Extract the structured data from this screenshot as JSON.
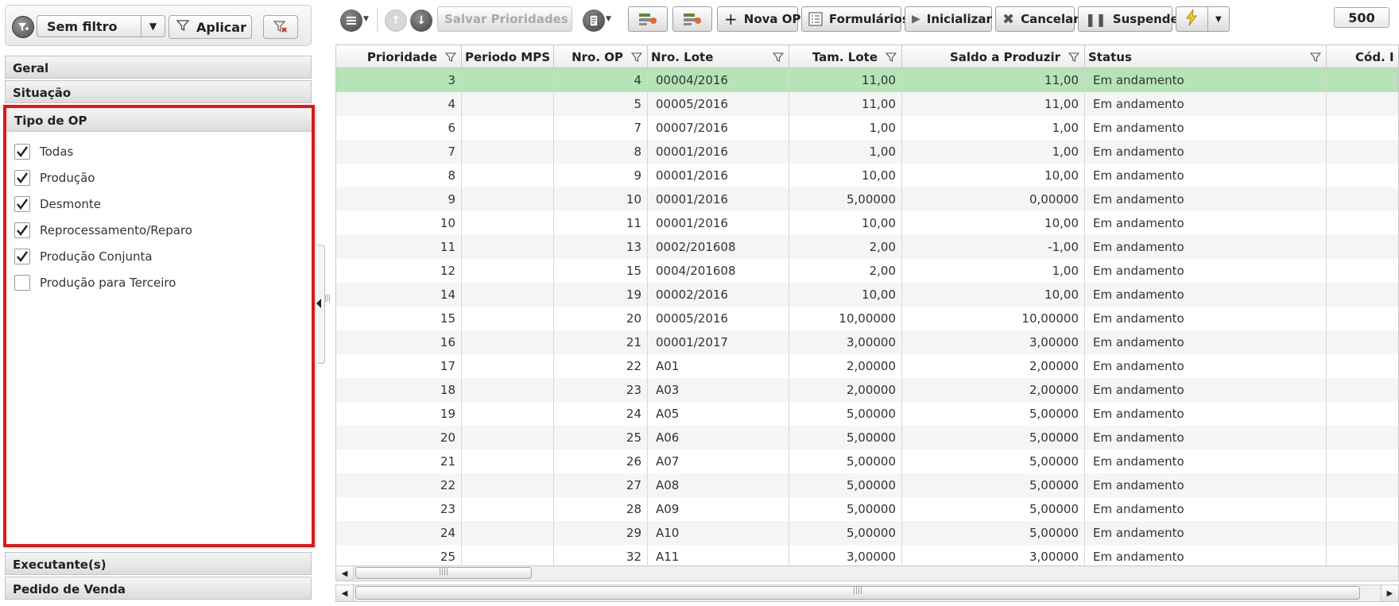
{
  "filter_bar": {
    "filter_select": "Sem filtro",
    "apply_label": "Aplicar"
  },
  "accordion": {
    "geral": "Geral",
    "situacao": "Situação",
    "tipo_op": "Tipo de OP",
    "executantes": "Executante(s)",
    "pedido_venda": "Pedido de Venda"
  },
  "tipo_op_options": [
    {
      "label": "Todas",
      "checked": true
    },
    {
      "label": "Produção",
      "checked": true
    },
    {
      "label": "Desmonte",
      "checked": true
    },
    {
      "label": "Reprocessamento/Reparo",
      "checked": true
    },
    {
      "label": "Produção Conjunta",
      "checked": true
    },
    {
      "label": "Produção para Terceiro",
      "checked": false
    }
  ],
  "toolbar": {
    "save_priorities": "Salvar Prioridades",
    "new_op": "Nova OP",
    "forms": "Formulários",
    "initialize": "Inicializar",
    "cancel": "Cancelar",
    "suspend": "Suspender",
    "page_size": "500"
  },
  "grid": {
    "headers": {
      "prioridade": "Prioridade",
      "periodo_mps": "Periodo MPS",
      "nro_op": "Nro. OP",
      "nro_lote": "Nro. Lote",
      "tam_lote": "Tam. Lote",
      "saldo": "Saldo a Produzir",
      "status": "Status",
      "cod": "Cód. I"
    },
    "rows": [
      {
        "prioridade": "3",
        "periodo": "",
        "op": "4",
        "lote": "00004/2016",
        "tam": "11,00",
        "saldo": "11,00",
        "status": "Em andamento"
      },
      {
        "prioridade": "4",
        "periodo": "",
        "op": "5",
        "lote": "00005/2016",
        "tam": "11,00",
        "saldo": "11,00",
        "status": "Em andamento"
      },
      {
        "prioridade": "6",
        "periodo": "",
        "op": "7",
        "lote": "00007/2016",
        "tam": "1,00",
        "saldo": "1,00",
        "status": "Em andamento"
      },
      {
        "prioridade": "7",
        "periodo": "",
        "op": "8",
        "lote": "00001/2016",
        "tam": "1,00",
        "saldo": "1,00",
        "status": "Em andamento"
      },
      {
        "prioridade": "8",
        "periodo": "",
        "op": "9",
        "lote": "00001/2016",
        "tam": "10,00",
        "saldo": "10,00",
        "status": "Em andamento"
      },
      {
        "prioridade": "9",
        "periodo": "",
        "op": "10",
        "lote": "00001/2016",
        "tam": "5,00000",
        "saldo": "0,00000",
        "status": "Em andamento"
      },
      {
        "prioridade": "10",
        "periodo": "",
        "op": "11",
        "lote": "00001/2016",
        "tam": "10,00",
        "saldo": "10,00",
        "status": "Em andamento"
      },
      {
        "prioridade": "11",
        "periodo": "",
        "op": "13",
        "lote": "0002/201608",
        "tam": "2,00",
        "saldo": "-1,00",
        "status": "Em andamento"
      },
      {
        "prioridade": "12",
        "periodo": "",
        "op": "15",
        "lote": "0004/201608",
        "tam": "2,00",
        "saldo": "1,00",
        "status": "Em andamento"
      },
      {
        "prioridade": "14",
        "periodo": "",
        "op": "19",
        "lote": "00002/2016",
        "tam": "10,00",
        "saldo": "10,00",
        "status": "Em andamento"
      },
      {
        "prioridade": "15",
        "periodo": "",
        "op": "20",
        "lote": "00005/2016",
        "tam": "10,00000",
        "saldo": "10,00000",
        "status": "Em andamento"
      },
      {
        "prioridade": "16",
        "periodo": "",
        "op": "21",
        "lote": "00001/2017",
        "tam": "3,00000",
        "saldo": "3,00000",
        "status": "Em andamento"
      },
      {
        "prioridade": "17",
        "periodo": "",
        "op": "22",
        "lote": "A01",
        "tam": "2,00000",
        "saldo": "2,00000",
        "status": "Em andamento"
      },
      {
        "prioridade": "18",
        "periodo": "",
        "op": "23",
        "lote": "A03",
        "tam": "2,00000",
        "saldo": "2,00000",
        "status": "Em andamento"
      },
      {
        "prioridade": "19",
        "periodo": "",
        "op": "24",
        "lote": "A05",
        "tam": "5,00000",
        "saldo": "5,00000",
        "status": "Em andamento"
      },
      {
        "prioridade": "20",
        "periodo": "",
        "op": "25",
        "lote": "A06",
        "tam": "5,00000",
        "saldo": "5,00000",
        "status": "Em andamento"
      },
      {
        "prioridade": "21",
        "periodo": "",
        "op": "26",
        "lote": "A07",
        "tam": "5,00000",
        "saldo": "5,00000",
        "status": "Em andamento"
      },
      {
        "prioridade": "22",
        "periodo": "",
        "op": "27",
        "lote": "A08",
        "tam": "5,00000",
        "saldo": "5,00000",
        "status": "Em andamento"
      },
      {
        "prioridade": "23",
        "periodo": "",
        "op": "28",
        "lote": "A09",
        "tam": "5,00000",
        "saldo": "5,00000",
        "status": "Em andamento"
      },
      {
        "prioridade": "24",
        "periodo": "",
        "op": "29",
        "lote": "A10",
        "tam": "5,00000",
        "saldo": "5,00000",
        "status": "Em andamento"
      },
      {
        "prioridade": "25",
        "periodo": "",
        "op": "32",
        "lote": "A11",
        "tam": "3,00000",
        "saldo": "3,00000",
        "status": "Em andamento"
      }
    ]
  },
  "colors": {
    "selected_row": "#b5e4b6",
    "highlight_border": "#ee1111"
  }
}
